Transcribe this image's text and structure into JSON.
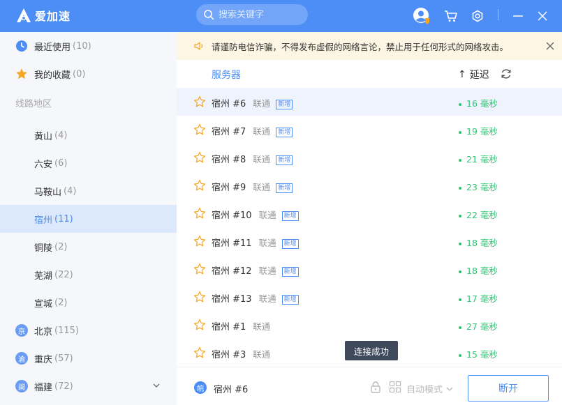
{
  "app": {
    "name": "爱加速"
  },
  "search": {
    "placeholder": "搜索关键字"
  },
  "sidebar": {
    "recent": {
      "label": "最近使用",
      "count": "(10)"
    },
    "favorites": {
      "label": "我的收藏",
      "count": "(0)"
    },
    "heading": "线路地区",
    "cities": [
      {
        "label": "黄山",
        "count": "(4)"
      },
      {
        "label": "六安",
        "count": "(6)"
      },
      {
        "label": "马鞍山",
        "count": "(4)"
      },
      {
        "label": "宿州",
        "count": "(11)"
      },
      {
        "label": "铜陵",
        "count": "(2)"
      },
      {
        "label": "芜湖",
        "count": "(22)"
      },
      {
        "label": "宣城",
        "count": "(2)"
      }
    ],
    "provinces": [
      {
        "badge": "京",
        "label": "北京",
        "count": "(115)"
      },
      {
        "badge": "渝",
        "label": "重庆",
        "count": "(57)"
      },
      {
        "badge": "闽",
        "label": "福建",
        "count": "(72)"
      }
    ]
  },
  "notice": {
    "text": "请谨防电信诈骗，不得发布虚假的网络言论，禁止用于任何形式的网络攻击。"
  },
  "list": {
    "col_server": "服务器",
    "col_latency": "延迟",
    "sort_arrow": "↑",
    "new_tag": "新增",
    "latency_unit": "毫秒",
    "rows": [
      {
        "name": "宿州 #6",
        "isp": "联通",
        "latency": "16",
        "isNew": true
      },
      {
        "name": "宿州 #7",
        "isp": "联通",
        "latency": "19",
        "isNew": true
      },
      {
        "name": "宿州 #8",
        "isp": "联通",
        "latency": "21",
        "isNew": true
      },
      {
        "name": "宿州 #9",
        "isp": "联通",
        "latency": "23",
        "isNew": true
      },
      {
        "name": "宿州 #10",
        "isp": "联通",
        "latency": "22",
        "isNew": true
      },
      {
        "name": "宿州 #11",
        "isp": "联通",
        "latency": "18",
        "isNew": true
      },
      {
        "name": "宿州 #12",
        "isp": "联通",
        "latency": "18",
        "isNew": true
      },
      {
        "name": "宿州 #13",
        "isp": "联通",
        "latency": "17",
        "isNew": true
      },
      {
        "name": "宿州 #1",
        "isp": "联通",
        "latency": "27",
        "isNew": false
      },
      {
        "name": "宿州 #3",
        "isp": "联通",
        "latency": "15",
        "isNew": false
      }
    ]
  },
  "toast": {
    "text": "连接成功"
  },
  "bottom": {
    "current_badge": "皖",
    "current_server": "宿州 #6",
    "mode_label": "自动模式",
    "disconnect_label": "断开"
  },
  "colors": {
    "brand": "#4c8df6",
    "latency_good": "#2ec770",
    "notice_bg": "#fdf6e4"
  }
}
